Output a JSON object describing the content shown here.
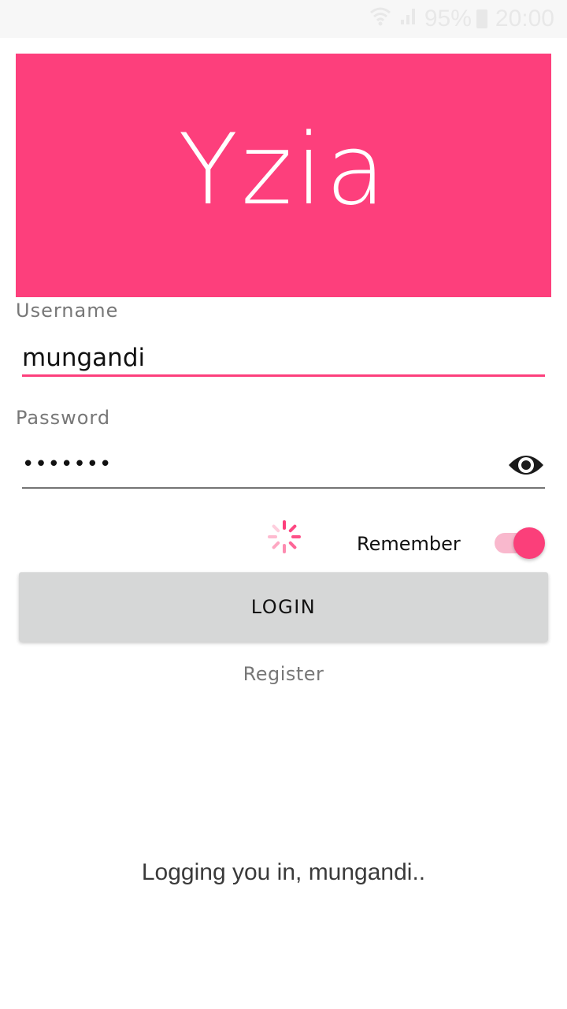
{
  "status_bar": {
    "battery": "95%",
    "time": "20:00",
    "icons": [
      "wifi-icon",
      "signal-icon",
      "battery-icon"
    ]
  },
  "banner": {
    "title": "Yzia",
    "color": "#fd3f7c"
  },
  "username": {
    "label": "Username",
    "value": "mungandi"
  },
  "password": {
    "label": "Password",
    "value": "•••••••",
    "toggle_icon": "eye-icon"
  },
  "remember": {
    "label": "Remember",
    "checked": true
  },
  "login_button": {
    "label": "LOGIN"
  },
  "register": {
    "label": "Register"
  },
  "status_message": "Logging you in, mungandi..",
  "colors": {
    "accent": "#fd3f7c",
    "button_bg": "#d6d7d7",
    "underline_inactive": "#757575"
  }
}
